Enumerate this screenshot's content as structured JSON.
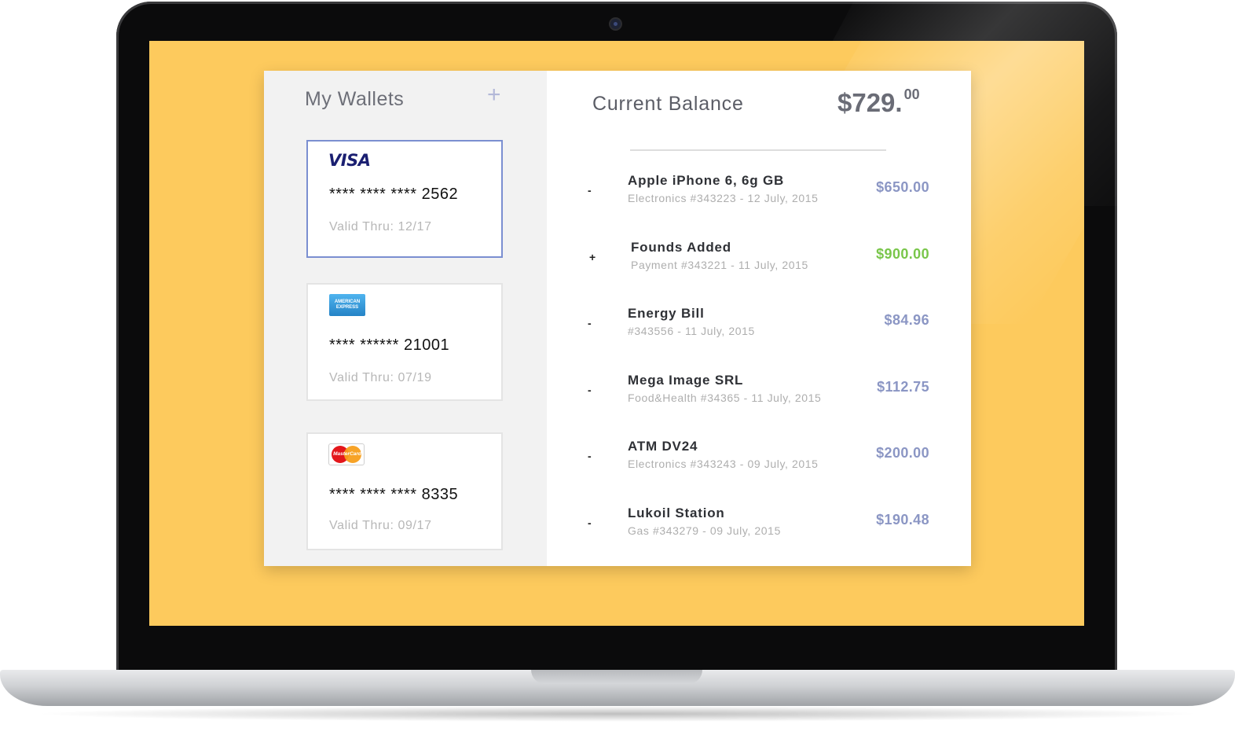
{
  "wallets": {
    "title": "My Wallets",
    "add_icon": "plus-icon",
    "add_label": "+",
    "cards": [
      {
        "brand": "visa",
        "brand_label": "VISA",
        "number": "**** **** **** 2562",
        "valid": "Valid Thru: 12/17",
        "selected": true
      },
      {
        "brand": "amex",
        "brand_label": "AMERICAN EXPRESS",
        "number": "**** ****** 21001",
        "valid": "Valid Thru: 07/19",
        "selected": false
      },
      {
        "brand": "mastercard",
        "brand_label": "MasterCard",
        "number": "**** **** **** 8335",
        "valid": "Valid Thru: 09/17",
        "selected": false
      }
    ]
  },
  "balance": {
    "label": "Current Balance",
    "amount_main": "$729.",
    "amount_cents": "00"
  },
  "transactions": [
    {
      "sign": "-",
      "title": "Apple iPhone 6, 6g GB",
      "sub": "Electronics #343223 - 12 July, 2015",
      "amount": "$650.00",
      "color": "#8b96c4"
    },
    {
      "sign": "+",
      "title": "Founds Added",
      "sub": "Payment #343221 - 11 July, 2015",
      "amount": "$900.00",
      "color": "#79c64a"
    },
    {
      "sign": "-",
      "title": "Energy Bill",
      "sub": "#343556 - 11 July, 2015",
      "amount": "$84.96",
      "color": "#8b96c4"
    },
    {
      "sign": "-",
      "title": "Mega Image SRL",
      "sub": "Food&Health #34365 - 11 July, 2015",
      "amount": "$112.75",
      "color": "#8b96c4"
    },
    {
      "sign": "-",
      "title": "ATM DV24",
      "sub": "Electronics #343243 - 09 July, 2015",
      "amount": "$200.00",
      "color": "#8b96c4"
    },
    {
      "sign": "-",
      "title": "Lukoil Station",
      "sub": "Gas #343279 - 09 July, 2015",
      "amount": "$190.48",
      "color": "#8b96c4"
    }
  ],
  "colors": {
    "screen_bg": "#fdca5d",
    "selected_border": "#7b8fd1",
    "debit_amount": "#8b96c4",
    "credit_amount": "#79c64a"
  }
}
